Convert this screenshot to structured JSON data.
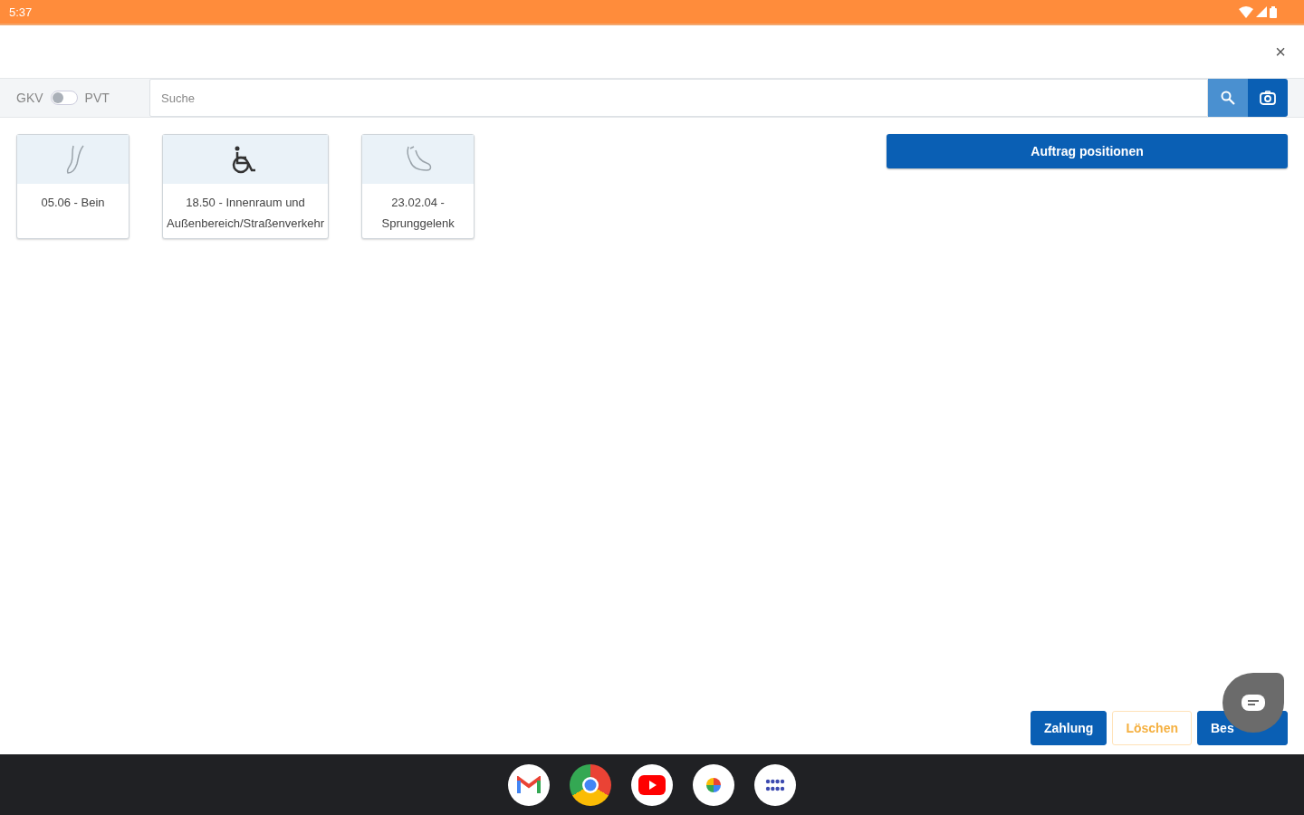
{
  "status_bar": {
    "time": "5:37"
  },
  "close_button": {
    "label": "×"
  },
  "insurance_toggle": {
    "left_label": "GKV",
    "right_label": "PVT",
    "on": false
  },
  "search": {
    "placeholder": "Suche"
  },
  "categories": [
    {
      "label": "05.06 - Bein",
      "kind": "leg"
    },
    {
      "label": "18.50 - Innenraum und Außenbereich/Straßenverkehr",
      "kind": "wheelchair"
    },
    {
      "label": "23.02.04 - Sprunggelenk",
      "kind": "foot"
    }
  ],
  "primary_action": {
    "label": "Auftrag positionen"
  },
  "footer_buttons": [
    {
      "label": "Zahlung",
      "kind": "primary"
    },
    {
      "label": "Löschen",
      "kind": "outline"
    },
    {
      "label": "Bes",
      "kind": "primary"
    }
  ]
}
